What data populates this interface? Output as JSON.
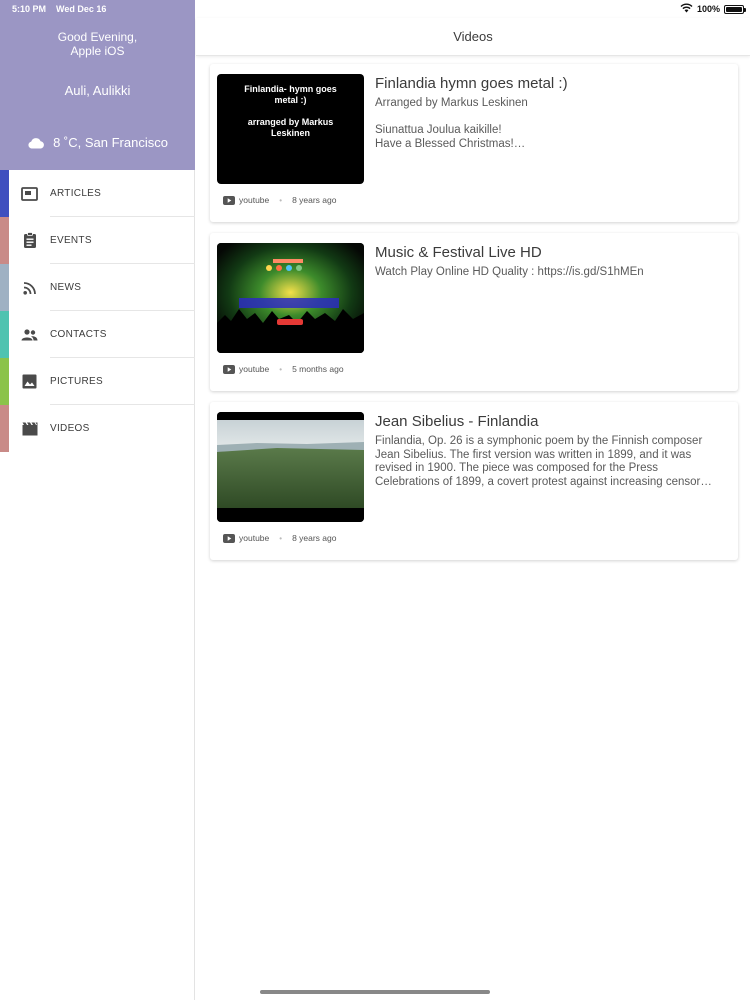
{
  "status_bar": {
    "time": "5:10 PM",
    "date": "Wed Dec 16",
    "battery": "100%"
  },
  "sidebar": {
    "greeting": "Good Evening,\nApple iOS",
    "user_name": "Auli, Aulikki",
    "weather": "8 ˚C, San Francisco",
    "header_color": "#9b96c4",
    "items": [
      {
        "label": "ARTICLES",
        "icon": "article-icon",
        "color": "#3f4fbf"
      },
      {
        "label": "EVENTS",
        "icon": "clipboard-icon",
        "color": "#c98a87"
      },
      {
        "label": "NEWS",
        "icon": "rss-icon",
        "color": "#9fb1c3"
      },
      {
        "label": "CONTACTS",
        "icon": "people-icon",
        "color": "#4fc3b0"
      },
      {
        "label": "PICTURES",
        "icon": "image-icon",
        "color": "#8bc34a"
      },
      {
        "label": "VIDEOS",
        "icon": "movie-clapper-icon",
        "color": "#c98a87"
      }
    ]
  },
  "main": {
    "title": "Videos",
    "videos": [
      {
        "title": "Finlandia hymn goes metal :)",
        "subtitle": "Arranged by Markus Leskinen",
        "description": "Siunattua Joulua kaikille!\nHave a Blessed Christmas!…",
        "thumb_text": "Finlandia- hymn goes\nmetal :)\n\narranged by Markus\nLeskinen",
        "source": "youtube",
        "age": "8 years ago"
      },
      {
        "title": "Music & Festival Live HD",
        "subtitle": "",
        "description": "Watch Play Online HD Quality : https://is.gd/S1hMEn",
        "thumb_text": "",
        "source": "youtube",
        "age": "5 months ago"
      },
      {
        "title": "Jean Sibelius - Finlandia",
        "subtitle": "",
        "description": "Finlandia, Op. 26 is a symphonic poem by the Finnish composer Jean Sibelius. The first version was written in 1899, and it was revised in 1900. The piece was composed for the Press Celebrations of 1899, a covert protest against increasing censor…",
        "thumb_text": "",
        "source": "youtube",
        "age": "8 years ago"
      }
    ]
  }
}
